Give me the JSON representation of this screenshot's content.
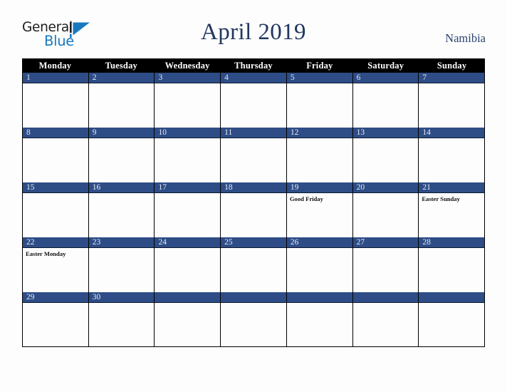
{
  "brand": {
    "name_part1": "General",
    "name_part2": "Blue",
    "mark_color": "#1878be"
  },
  "header": {
    "title": "April 2019",
    "country": "Namibia",
    "title_color": "#21365f"
  },
  "calendar": {
    "accent_color": "#2e4d87",
    "header_bg": "#000000",
    "weekday_headers": [
      "Monday",
      "Tuesday",
      "Wednesday",
      "Thursday",
      "Friday",
      "Saturday",
      "Sunday"
    ],
    "weeks": [
      [
        {
          "day": "1",
          "events": []
        },
        {
          "day": "2",
          "events": []
        },
        {
          "day": "3",
          "events": []
        },
        {
          "day": "4",
          "events": []
        },
        {
          "day": "5",
          "events": []
        },
        {
          "day": "6",
          "events": []
        },
        {
          "day": "7",
          "events": []
        }
      ],
      [
        {
          "day": "8",
          "events": []
        },
        {
          "day": "9",
          "events": []
        },
        {
          "day": "10",
          "events": []
        },
        {
          "day": "11",
          "events": []
        },
        {
          "day": "12",
          "events": []
        },
        {
          "day": "13",
          "events": []
        },
        {
          "day": "14",
          "events": []
        }
      ],
      [
        {
          "day": "15",
          "events": []
        },
        {
          "day": "16",
          "events": []
        },
        {
          "day": "17",
          "events": []
        },
        {
          "day": "18",
          "events": []
        },
        {
          "day": "19",
          "events": [
            "Good Friday"
          ]
        },
        {
          "day": "20",
          "events": []
        },
        {
          "day": "21",
          "events": [
            "Easter Sunday"
          ]
        }
      ],
      [
        {
          "day": "22",
          "events": [
            "Easter Monday"
          ]
        },
        {
          "day": "23",
          "events": []
        },
        {
          "day": "24",
          "events": []
        },
        {
          "day": "25",
          "events": []
        },
        {
          "day": "26",
          "events": []
        },
        {
          "day": "27",
          "events": []
        },
        {
          "day": "28",
          "events": []
        }
      ],
      [
        {
          "day": "29",
          "events": []
        },
        {
          "day": "30",
          "events": []
        },
        {
          "day": "",
          "events": []
        },
        {
          "day": "",
          "events": []
        },
        {
          "day": "",
          "events": []
        },
        {
          "day": "",
          "events": []
        },
        {
          "day": "",
          "events": []
        }
      ]
    ]
  }
}
